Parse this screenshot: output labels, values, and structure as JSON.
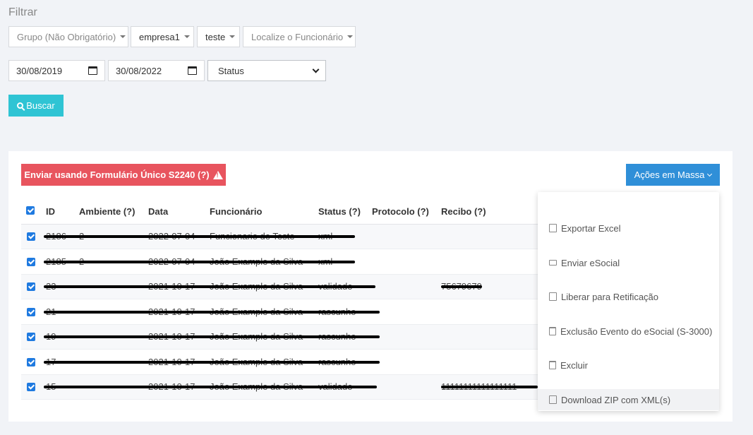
{
  "filter": {
    "title": "Filtrar",
    "dropdowns": [
      "Grupo (Não Obrigatório)",
      "empresa1",
      "teste",
      "Localize o Funcionário"
    ],
    "date_from": "30/08/2019",
    "date_to": "30/08/2022",
    "status_placeholder": "Status",
    "search_button": "Buscar"
  },
  "actions": {
    "send_form_button": "Enviar usando Formulário Único S2240 (?)",
    "bulk_button": "Ações em Massa"
  },
  "table": {
    "headers": [
      "ID",
      "Ambiente (?)",
      "Data",
      "Funcionário",
      "Status (?)",
      "Protocolo (?)",
      "Recibo (?)"
    ],
    "rows": [
      {
        "id": "2186",
        "ambiente": "2",
        "data": "2022-07-04",
        "funcionario": "Funcionario de Teste",
        "status": "xml",
        "recibo": ""
      },
      {
        "id": "2185",
        "ambiente": "2",
        "data": "2022-07-04",
        "funcionario": "João Example da Silva",
        "status": "xml",
        "recibo": ""
      },
      {
        "id": "23",
        "ambiente": "",
        "data": "2021-10-17",
        "funcionario": "João Example da Silva",
        "status": "validado",
        "recibo": "75679679"
      },
      {
        "id": "21",
        "ambiente": "",
        "data": "2021-10-17",
        "funcionario": "João Example da Silva",
        "status": "rascunho",
        "recibo": ""
      },
      {
        "id": "19",
        "ambiente": "",
        "data": "2021-10-17",
        "funcionario": "João Example da Silva",
        "status": "rascunho",
        "recibo": ""
      },
      {
        "id": "17",
        "ambiente": "",
        "data": "2021-10-17",
        "funcionario": "João Example da Silva",
        "status": "rascunho",
        "recibo": ""
      },
      {
        "id": "15",
        "ambiente": "",
        "data": "2021-10-17",
        "funcionario": "João Example da Silva",
        "status": "validado",
        "recibo": "11111111111111111"
      }
    ]
  },
  "menu": {
    "items": [
      {
        "label": "Exportar Excel",
        "icon": "file-excel-icon"
      },
      {
        "label": "Enviar eSocial",
        "icon": "server-icon"
      },
      {
        "label": "Liberar para Retificação",
        "icon": "edit-icon"
      },
      {
        "label": "Exclusão Evento do eSocial (S-3000)",
        "icon": "trash-icon"
      },
      {
        "label": "Excluir",
        "icon": "trash-icon"
      },
      {
        "label": "Download ZIP com XML(s)",
        "icon": "file-zip-icon"
      }
    ]
  },
  "colors": {
    "search": "#2fc4d4",
    "danger": "#e8545e",
    "primary": "#2f8fd8",
    "checkbox": "#1f7ae0"
  }
}
